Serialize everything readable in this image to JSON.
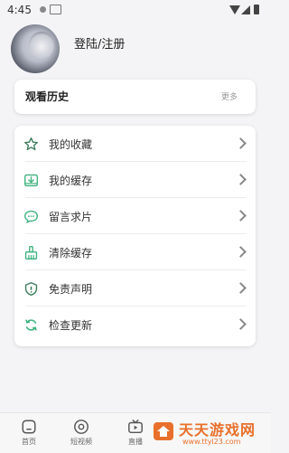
{
  "status_bar": {
    "time": "4:45"
  },
  "profile": {
    "login_label": "登陆/注册"
  },
  "history": {
    "title": "观看历史",
    "more_label": "更多"
  },
  "menu": {
    "items": [
      {
        "label": "我的收藏",
        "icon": "star-icon"
      },
      {
        "label": "我的缓存",
        "icon": "download-icon"
      },
      {
        "label": "留言求片",
        "icon": "comment-icon"
      },
      {
        "label": "清除缓存",
        "icon": "broom-icon"
      },
      {
        "label": "免责声明",
        "icon": "shield-icon"
      },
      {
        "label": "检查更新",
        "icon": "refresh-icon"
      }
    ]
  },
  "bottom_nav": {
    "items": [
      {
        "label": "首页",
        "icon": "home-icon"
      },
      {
        "label": "短视频",
        "icon": "play-circle-icon"
      },
      {
        "label": "直播",
        "icon": "tv-icon"
      }
    ]
  },
  "watermark": {
    "title": "天天游戏网",
    "url": "www.ttyl23.com"
  },
  "colors": {
    "accent_green": "#3fb27f",
    "watermark_orange": "#e8702a"
  }
}
